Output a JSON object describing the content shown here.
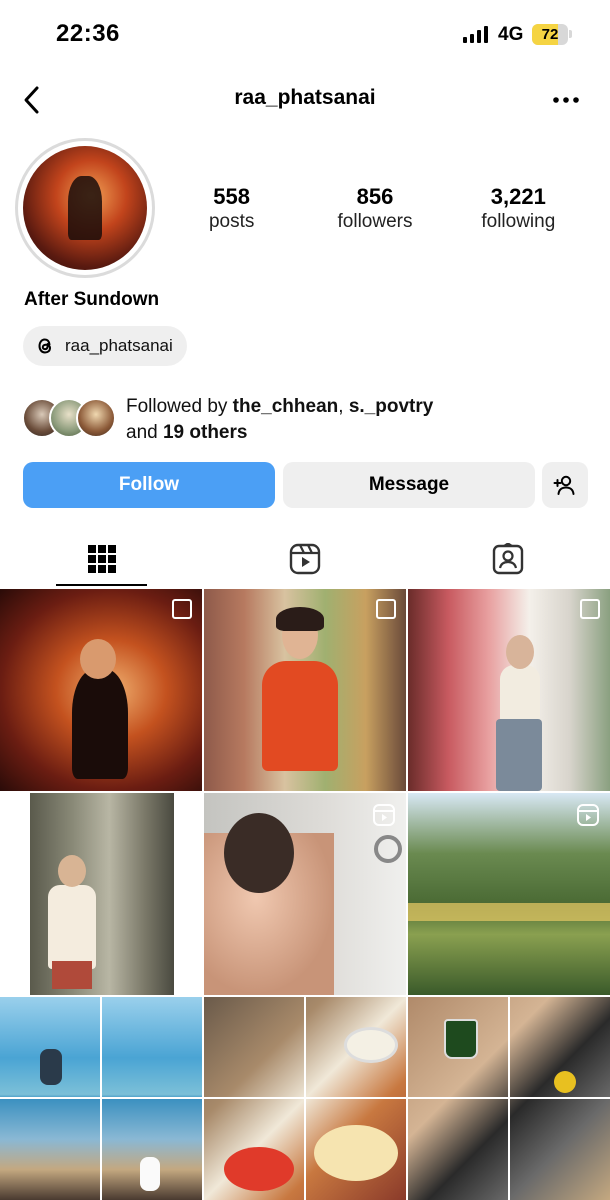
{
  "status_bar": {
    "time": "22:36",
    "network": "4G",
    "battery": "72",
    "battery_level": 0.72
  },
  "nav": {
    "title": "raa_phatsanai",
    "back_icon": "chevron-left-icon",
    "more_icon": "more-horizontal-icon"
  },
  "profile": {
    "stats": [
      {
        "value": "558",
        "label": "posts"
      },
      {
        "value": "856",
        "label": "followers"
      },
      {
        "value": "3,221",
        "label": "following"
      }
    ],
    "display_name": "After Sundown",
    "threads_handle": "raa_phatsanai"
  },
  "followed_by": {
    "prefix": "Followed by ",
    "name1": "the_chhean",
    "separator": ", ",
    "name2": "s._povtry",
    "line2_prefix": "and ",
    "others": "19 others"
  },
  "actions": {
    "follow": "Follow",
    "message": "Message",
    "add_icon": "add-person-icon"
  },
  "tabs": [
    {
      "icon": "grid-icon",
      "active": true
    },
    {
      "icon": "reels-icon",
      "active": false
    },
    {
      "icon": "tagged-icon",
      "active": false
    }
  ],
  "colors": {
    "follow_button": "#4b9ff5",
    "secondary_button": "#efefef",
    "battery": "#f5d443"
  }
}
